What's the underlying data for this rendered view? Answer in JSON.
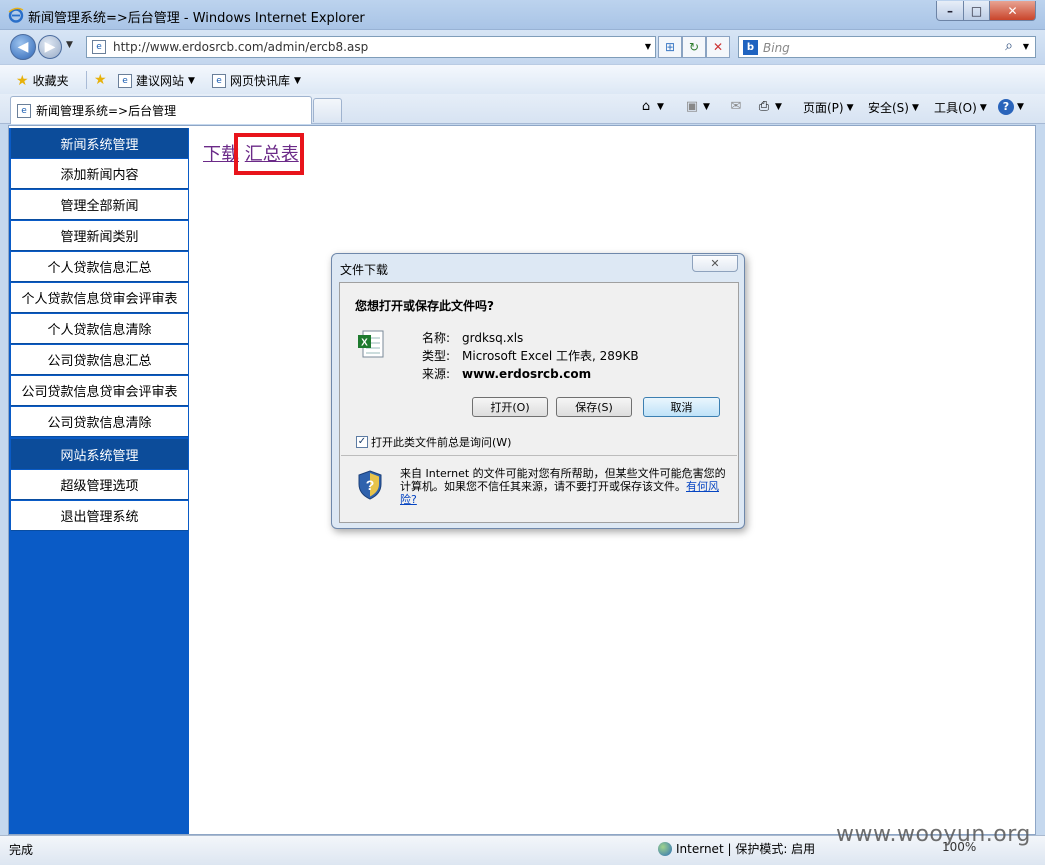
{
  "window": {
    "title": "新闻管理系统=>后台管理 - Windows Internet Explorer",
    "min_symbol": "–",
    "max_symbol": "□",
    "close_symbol": "✕"
  },
  "nav": {
    "back_symbol": "◀",
    "forward_symbol": "▶",
    "url": "http://www.erdosrcb.com/admin/ercb8.asp",
    "search_placeholder": "Bing"
  },
  "favorites": {
    "label": "收藏夹",
    "items": [
      "建议网站",
      "网页快讯库"
    ]
  },
  "tab": {
    "label": "新闻管理系统=>后台管理"
  },
  "commandbar": {
    "page": "页面(P)",
    "safety": "安全(S)",
    "tools": "工具(O)"
  },
  "sidebar": {
    "sections": [
      {
        "header": "新闻系统管理",
        "items": [
          "添加新闻内容",
          "管理全部新闻",
          "管理新闻类别",
          "个人贷款信息汇总",
          "个人贷款信息贷审会评审表",
          "个人贷款信息清除",
          "公司贷款信息汇总",
          "公司贷款信息贷审会评审表",
          "公司贷款信息清除"
        ]
      },
      {
        "header": "网站系统管理",
        "items": [
          "超级管理选项",
          "退出管理系统"
        ]
      }
    ]
  },
  "main": {
    "link_download": "下载",
    "link_summary": "汇总表"
  },
  "dialog": {
    "title": "文件下载",
    "question": "您想打开或保存此文件吗?",
    "name_label": "名称:",
    "name_value": "grdksq.xls",
    "type_label": "类型:",
    "type_value": "Microsoft Excel 工作表, 289KB",
    "source_label": "来源:",
    "source_value": "www.erdosrcb.com",
    "open_button": "打开(O)",
    "save_button": "保存(S)",
    "cancel_button": "取消",
    "checkbox_label": "打开此类文件前总是询问(W)",
    "checkbox_checked": true,
    "warning_text": "来自 Internet 的文件可能对您有所帮助，但某些文件可能危害您的计算机。如果您不信任其来源，请不要打开或保存该文件。",
    "risk_link": "有何风险?"
  },
  "status": {
    "text": "完成",
    "zone": "Internet | 保护模式: 启用",
    "zoom": "100%"
  },
  "watermark": "www.wooyun.org",
  "colors": {
    "sidebar_bg": "#0a5bc6",
    "sidebar_header": "#0c4c9a",
    "highlight": "#e8141b",
    "link_visited": "#6b2a88"
  }
}
